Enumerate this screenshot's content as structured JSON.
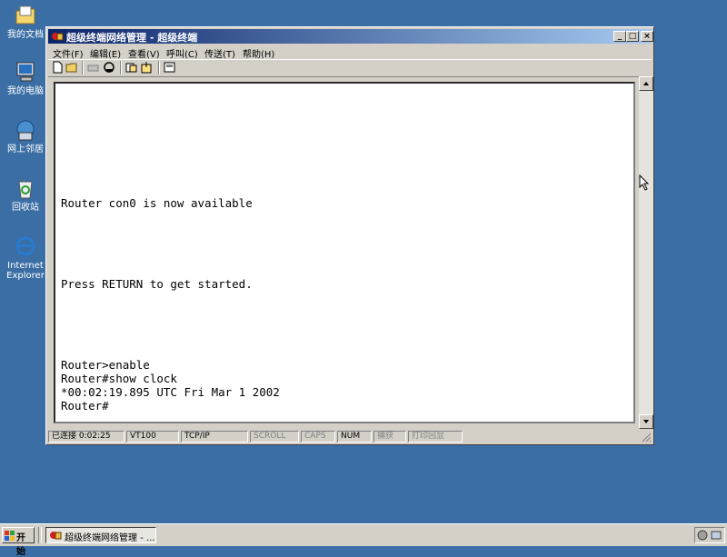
{
  "desktop": {
    "icons": [
      {
        "label": "我的文档",
        "icon": "folder-icon"
      },
      {
        "label": "我的电脑",
        "icon": "computer-icon"
      },
      {
        "label": "网上邻居",
        "icon": "network-icon"
      },
      {
        "label": "回收站",
        "icon": "recycle-bin-icon"
      },
      {
        "label": "Internet\nExplorer",
        "icon": "ie-icon"
      }
    ]
  },
  "window": {
    "title": "超级终端网络管理 - 超级终端",
    "minimize": "_",
    "maximize": "□",
    "close": "×",
    "menu": [
      "文件(F)",
      "编辑(E)",
      "查看(V)",
      "呼叫(C)",
      "传送(T)",
      "帮助(H)"
    ],
    "toolbar": [
      "new-icon",
      "open-icon",
      "disconnect-icon",
      "call-icon",
      "send-icon",
      "receive-icon",
      "properties-icon"
    ]
  },
  "terminal": {
    "lines": [
      "Router con0 is now available",
      "Press RETURN to get started.",
      "Router>enable",
      "Router#show clock",
      "*00:02:19.895 UTC Fri Mar 1 2002",
      "Router#"
    ]
  },
  "statusbar": {
    "connected": "已连接 0:02:25",
    "emulation": "VT100",
    "protocol": "TCP/IP",
    "scroll": "SCROLL",
    "caps": "CAPS",
    "num": "NUM",
    "capture": "捕获",
    "echo": "打印回显"
  },
  "taskbar": {
    "start": "开始",
    "task": "超级终端网络管理 - ..."
  },
  "colors": {
    "desktop": "#3a6ea5",
    "title_start": "#0a246a",
    "title_end": "#a6caf0",
    "chrome": "#d4d0c8"
  }
}
